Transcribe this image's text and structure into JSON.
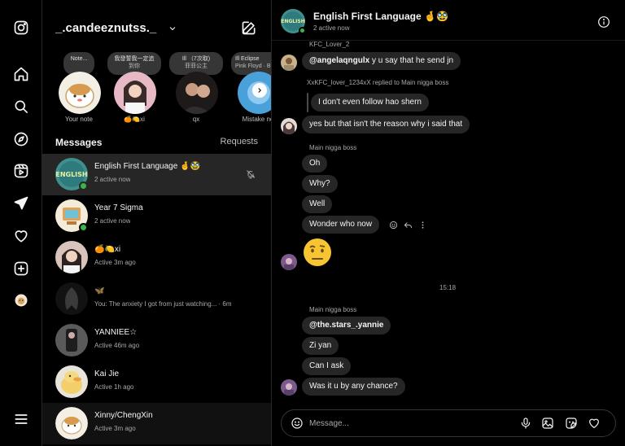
{
  "app": {
    "username": "_.candeeznutss._",
    "icons": {
      "rail": [
        "instagram-logo-icon",
        "home-icon",
        "search-icon",
        "explore-icon",
        "reels-icon",
        "messages-icon",
        "notifications-heart-icon",
        "create-plus-icon",
        "profile-avatar-icon",
        "more-menu-icon"
      ],
      "compose": "compose-icon"
    }
  },
  "notes": [
    {
      "bubble": "Note...",
      "bubble2": "",
      "label": "Your note"
    },
    {
      "bubble": "我發誓我一定追",
      "bubble2": "到你",
      "label": "🍊🍋xi"
    },
    {
      "bubble": "Ill （7次取)",
      "bubble2": "菲菲公主",
      "label": "qx"
    },
    {
      "bubble": "Ill Eclipse",
      "bubble2": "Pink Floyd · Bro all thang",
      "label": "Mistake no"
    }
  ],
  "inbox": {
    "heading": "Messages",
    "requests": "Requests",
    "threads": [
      {
        "name": "English First Language 🤞🥸",
        "sub": "2 active now",
        "online": true,
        "muted": true
      },
      {
        "name": "Year 7 Sigma",
        "sub": "2 active now",
        "online": true,
        "muted": false
      },
      {
        "name": "🍊🍋xi",
        "sub": "Active 3m ago",
        "online": false,
        "muted": false
      },
      {
        "name": "🦋",
        "sub": "You: The anxiety I got from just watching... · 6m",
        "online": false,
        "muted": false
      },
      {
        "name": "YANNIEE☆",
        "sub": "Active 46m ago",
        "online": false,
        "muted": false
      },
      {
        "name": "Kai Jie",
        "sub": "Active 1h ago",
        "online": false,
        "muted": false
      },
      {
        "name": "Xinny/ChengXin",
        "sub": "Active 3m ago",
        "online": false,
        "muted": false
      }
    ]
  },
  "chat": {
    "title": "English First Language 🤞🥸",
    "subtitle": "2 active now",
    "messages": {
      "sender_top": "KFC_Lover_2",
      "m1_mention": "@angelaqngulx",
      "m1_text": " y u say that he send jn",
      "reply_label": "XxKFC_lover_1234xX replied to Main nigga boss",
      "m2": "I don't even follow hao shern",
      "m3": "yes but that isn't the reason why i said that",
      "sender_main": "Main nigga boss",
      "m4": "Oh",
      "m5": "Why?",
      "m6": "Well",
      "m7": "Wonder who now",
      "big_emoji": "face-with-raised-eyebrow",
      "time": "15:18",
      "sender_main2": "Main nigga boss",
      "m8": "@the.stars_.yannie",
      "m9": "Zi yan",
      "m10": "Can I ask",
      "m11": "Was it u by any chance?"
    },
    "composer": {
      "placeholder": "Message..."
    }
  }
}
